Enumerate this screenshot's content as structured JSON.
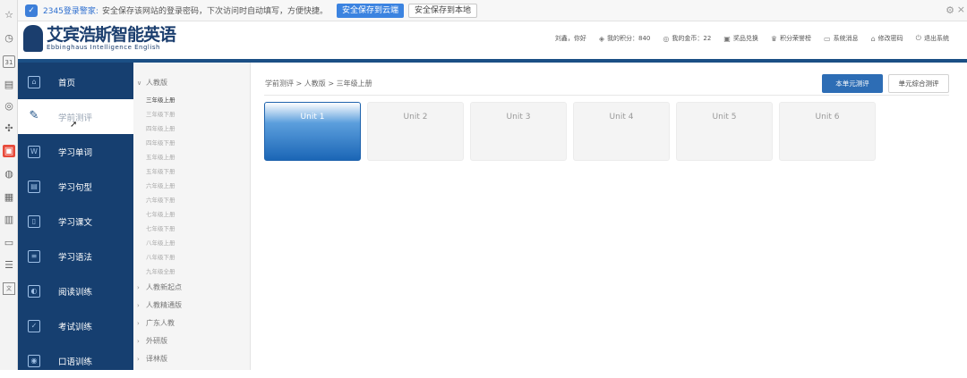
{
  "browser_toolbar": {
    "icons": [
      "star-icon",
      "clock-icon",
      "calendar-icon",
      "app-icon",
      "chat-icon",
      "chain-icon",
      "shop-icon",
      "game-icon",
      "grid-icon",
      "film-icon",
      "save-icon",
      "list-icon",
      "translate-icon"
    ],
    "calendar_day": "31",
    "grid_badge": "1"
  },
  "password_bar": {
    "brand": "2345登录警家:",
    "message": "安全保存该网站的登录密码，下次访问时自动填写，方便快捷。",
    "save_cloud": "安全保存到云端",
    "save_local": "安全保存到本地"
  },
  "header": {
    "logo_cn": "艾宾浩斯智能英语",
    "logo_en": "Ebbinghaus Intelligence English",
    "greeting": "刘鑫，你好",
    "nav": [
      {
        "label": "我的积分：840",
        "icon": "coins-icon"
      },
      {
        "label": "我的金币：22",
        "icon": "gold-icon"
      },
      {
        "label": "奖品兑换",
        "icon": "gift-icon"
      },
      {
        "label": "积分荣誉榜",
        "icon": "trophy-icon"
      },
      {
        "label": "系统消息",
        "icon": "message-icon"
      },
      {
        "label": "修改密码",
        "icon": "lock-icon"
      },
      {
        "label": "退出系统",
        "icon": "power-icon"
      }
    ]
  },
  "sidebar": {
    "items": [
      {
        "label": "首页",
        "icon": "home-icon"
      },
      {
        "label": "学前测评",
        "icon": "pencil-icon"
      },
      {
        "label": "学习单词",
        "icon": "word-icon"
      },
      {
        "label": "学习句型",
        "icon": "book-icon"
      },
      {
        "label": "学习课文",
        "icon": "document-icon"
      },
      {
        "label": "学习语法",
        "icon": "grammar-icon"
      },
      {
        "label": "阅读训练",
        "icon": "reading-icon"
      },
      {
        "label": "考试训练",
        "icon": "exam-icon"
      },
      {
        "label": "口语训练",
        "icon": "speaking-icon"
      }
    ]
  },
  "tree": {
    "root": "人教版",
    "grades": [
      "三年级上册",
      "三年级下册",
      "四年级上册",
      "四年级下册",
      "五年级上册",
      "五年级下册",
      "六年级上册",
      "六年级下册",
      "七年级上册",
      "七年级下册",
      "八年级上册",
      "八年级下册",
      "九年级全册"
    ],
    "others": [
      "人教新起点",
      "人教精通版",
      "广东人教",
      "外研版",
      "译林版"
    ]
  },
  "main": {
    "breadcrumb": "学前测评 > 人教版 > 三年级上册",
    "unit_test_button": "本单元测评",
    "combined_test_button": "单元综合测评",
    "units": [
      "Unit 1",
      "Unit 2",
      "Unit 3",
      "Unit 4",
      "Unit 5",
      "Unit 6"
    ]
  }
}
